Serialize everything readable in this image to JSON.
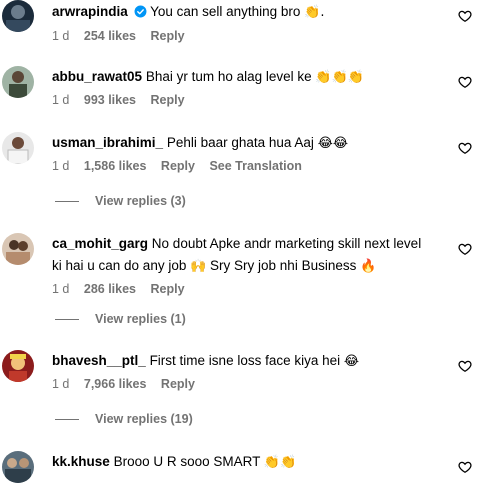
{
  "comments": [
    {
      "username": "arwrapindia",
      "verified": true,
      "text": "You can sell anything bro ",
      "emoji": "👏.",
      "time": "1 d",
      "likes": "254 likes",
      "reply": "Reply"
    },
    {
      "username": "abbu_rawat05",
      "text": "Bhai yr tum ho alag level ke ",
      "emoji": "👏👏👏",
      "time": "1 d",
      "likes": "993 likes",
      "reply": "Reply"
    },
    {
      "username": "usman_ibrahimi_",
      "text": "Pehli baar ghata hua Aaj ",
      "emoji": "😂😂",
      "time": "1 d",
      "likes": "1,586 likes",
      "reply": "Reply",
      "see_translation": "See Translation",
      "view_replies": "View replies (3)"
    },
    {
      "username": "ca_mohit_garg",
      "text": "No doubt Apke andr marketing skill next level",
      "text_line2": "ki hai u can do any job ",
      "emoji2": "🙌",
      "text_line2b": " Sry Sry job nhi Business ",
      "emoji3": "🔥",
      "time": "1 d",
      "likes": "286 likes",
      "reply": "Reply",
      "view_replies": "View replies (1)"
    },
    {
      "username": "bhavesh__ptl_",
      "text": "First time isne loss face kiya hei ",
      "emoji": "😂",
      "time": "1 d",
      "likes": "7,966 likes",
      "reply": "Reply",
      "view_replies": "View replies (19)"
    },
    {
      "username": "kk.khuse",
      "text": "Brooo U R sooo SMART ",
      "emoji": "👏👏",
      "time": "",
      "likes": "",
      "reply": ""
    }
  ],
  "colors": {
    "verified_blue": "#0095f6",
    "meta_gray": "#737373"
  },
  "icons": {
    "like": "heart-outline-icon",
    "verified": "verified-badge-icon"
  }
}
